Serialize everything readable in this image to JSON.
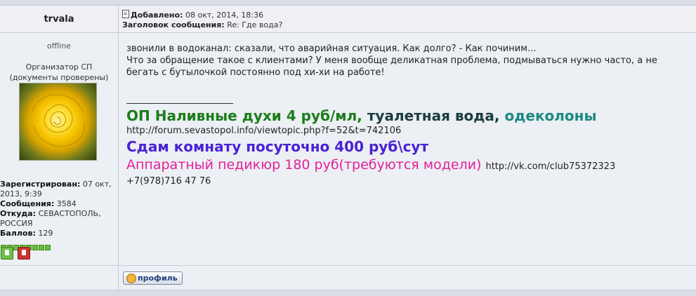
{
  "author": {
    "name": "trvala",
    "status": "offline",
    "rank_line1": "Организатор СП",
    "rank_line2": "(документы проверены)",
    "registered_label": "Зарегистрирован:",
    "registered_value": "07 окт, 2013, 9:39",
    "posts_label": "Сообщения:",
    "posts_value": "3584",
    "from_label": "Откуда:",
    "from_value": "СЕВАСТОПОЛЬ, РОССИЯ",
    "points_label": "Баллов:",
    "points_value": "129",
    "rating_dots": 8,
    "vote_up_icon": "thumb-up-icon",
    "vote_down_icon": "thumb-down-icon"
  },
  "post": {
    "added_label": "Добавлено:",
    "added_value": "08 окт, 2014, 18:36",
    "subject_label": "Заголовок сообщения:",
    "subject_value": "Re: Где вода?",
    "body_lines": [
      "звонили в водоканал: сказали, что аварийная ситуация. Как долго? - Как починим...",
      "Что за обращение такое с клиентами? У меня вообще деликатная проблема, подмываться нужно часто, а не бегать с бутылочкой постоянно под хи-хи на работе!"
    ]
  },
  "signature": {
    "line1_part1": "ОП Наливные духи 4 руб/мл,",
    "line1_part2": "туалетная вода,",
    "line1_part3": "одеколоны",
    "line2_url": "http://forum.sevastopol.info/viewtopic.php?f=52&t=742106",
    "line3": "Сдам комнату посуточно 400 руб\\сут",
    "line4_text": "Аппаратный педикюр 180 руб(требуются модели)",
    "line4_url": "http://vk.com/club75372323",
    "line5_phone": "+7(978)716 47 76"
  },
  "footer": {
    "profile_label": "профиль"
  },
  "colors": {
    "sig_green": "#1b7d1b",
    "sig_teal": "#1b8a84",
    "sig_purple": "#4a22d4",
    "sig_pink": "#e2209a"
  }
}
